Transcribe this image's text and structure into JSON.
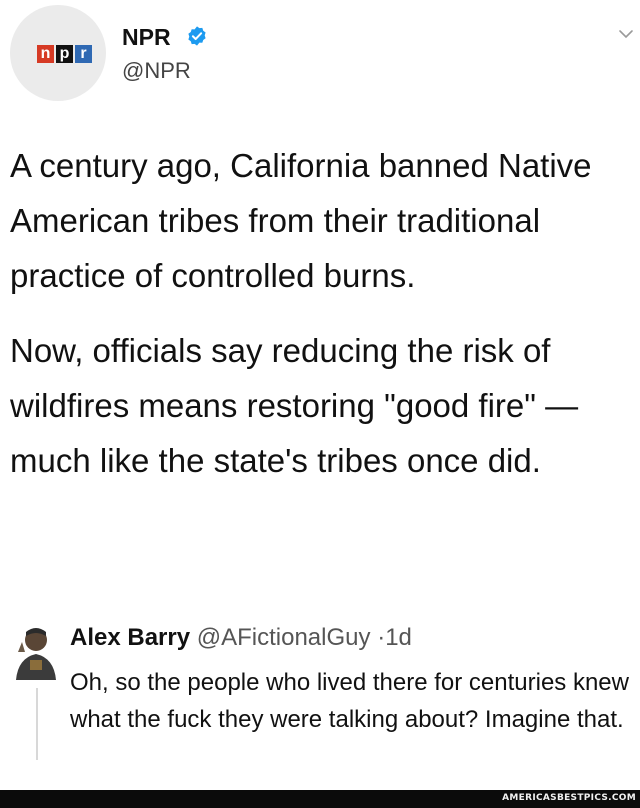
{
  "tweet": {
    "author_name": "NPR",
    "author_handle": "@NPR",
    "logo_letters": [
      "n",
      "p",
      "r"
    ],
    "paragraphs": [
      "A century ago, California banned Native American tribes from their traditional practice of controlled burns.",
      "Now, officials say reducing the risk of wildfires means restoring \"good fire\" — much like the state's tribes once did."
    ],
    "icons": {
      "verified": "verified-badge-icon",
      "menu": "chevron-down-icon"
    }
  },
  "reply": {
    "name": "Alex Barry",
    "handle": "@AFictionalGuy",
    "separator": "·",
    "age": "1d",
    "text": "Oh, so the people who lived there for centuries knew what the fuck they were talking about? Imagine that."
  },
  "footer": {
    "watermark": "AMERICASBESTPICS.COM"
  },
  "colors": {
    "npr_red": "#d63a24",
    "npr_black": "#111111",
    "npr_blue": "#2f69b3",
    "verified_blue": "#1d9bf0",
    "footer_bg": "#0b0b0b"
  }
}
